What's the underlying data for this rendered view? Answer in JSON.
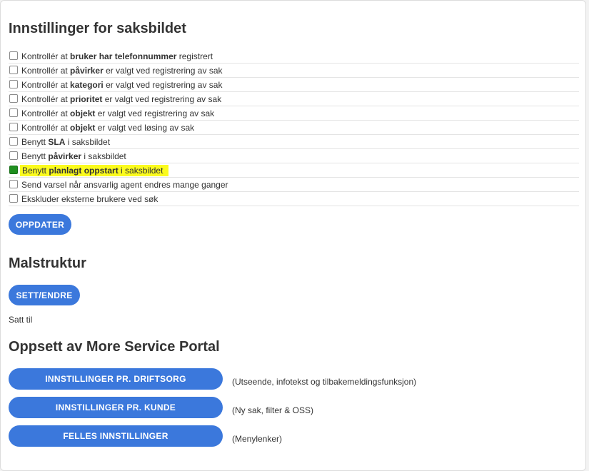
{
  "settings": {
    "title": "Innstillinger for saksbildet",
    "items": [
      {
        "pre": "Kontrollér at ",
        "bold": "bruker har telefonnummer",
        "post": " registrert",
        "checked": false
      },
      {
        "pre": "Kontrollér at ",
        "bold": "påvirker",
        "post": " er valgt ved registrering av sak",
        "checked": false
      },
      {
        "pre": "Kontrollér at ",
        "bold": "kategori",
        "post": " er valgt ved registrering av sak",
        "checked": false
      },
      {
        "pre": "Kontrollér at ",
        "bold": "prioritet",
        "post": " er valgt ved registrering av sak",
        "checked": false
      },
      {
        "pre": "Kontrollér at ",
        "bold": "objekt",
        "post": " er valgt ved registrering av sak",
        "checked": false
      },
      {
        "pre": "Kontrollér at ",
        "bold": "objekt",
        "post": " er valgt ved løsing av sak",
        "checked": false
      },
      {
        "pre": "Benytt ",
        "bold": "SLA",
        "post": " i saksbildet",
        "checked": false
      },
      {
        "pre": "Benytt ",
        "bold": "påvirker",
        "post": " i saksbildet",
        "checked": false
      },
      {
        "pre": "Benytt ",
        "bold": "planlagt oppstart",
        "post": " i saksbildet",
        "checked": true,
        "highlight": true
      },
      {
        "pre": "Send varsel når ansvarlig agent endres mange ganger",
        "bold": "",
        "post": "",
        "checked": false
      },
      {
        "pre": "Ekskluder eksterne brukere ved søk",
        "bold": "",
        "post": "",
        "checked": false
      }
    ],
    "update_label": "OPPDATER"
  },
  "template": {
    "title": "Malstruktur",
    "set_label": "SETT/ENDRE",
    "status": "Satt til"
  },
  "portal": {
    "title": "Oppsett av More Service Portal",
    "buttons": [
      {
        "label": "INNSTILLINGER PR. DRIFTSORG",
        "note": "(Utseende, infotekst og tilbakemeldingsfunksjon)"
      },
      {
        "label": "INNSTILLINGER PR. KUNDE",
        "note": "(Ny sak, filter & OSS)"
      },
      {
        "label": "FELLES INNSTILLINGER",
        "note": "(Menylenker)"
      }
    ]
  },
  "colors": {
    "button": "#3b78dc",
    "checked": "#1f8f1f",
    "highlight": "#fbfb1e"
  }
}
